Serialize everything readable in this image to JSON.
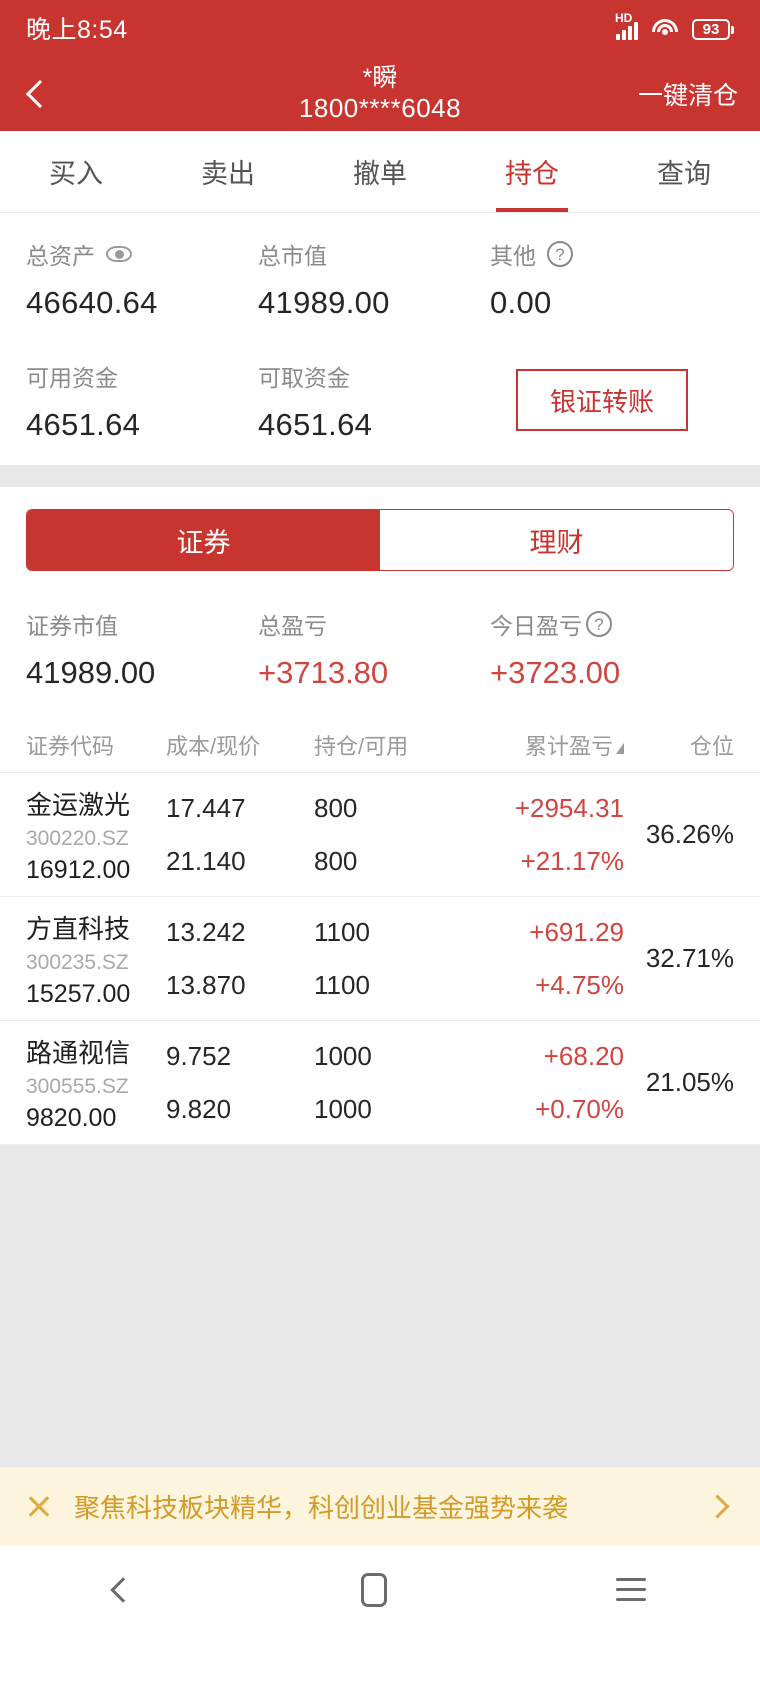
{
  "status_bar": {
    "time": "晚上8:54",
    "hd_label": "HD",
    "battery_level": "93",
    "icons": [
      "signal-icon",
      "wifi-icon",
      "battery-icon"
    ]
  },
  "header": {
    "back_icon": "chevron-left-icon",
    "title_line1": "*瞬",
    "title_line2": "1800****6048",
    "action_label": "一键清仓"
  },
  "tabs": [
    {
      "label": "买入",
      "active": false
    },
    {
      "label": "卖出",
      "active": false
    },
    {
      "label": "撤单",
      "active": false
    },
    {
      "label": "持仓",
      "active": true
    },
    {
      "label": "查询",
      "active": false
    }
  ],
  "assets": {
    "total_assets_label": "总资产",
    "total_assets_value": "46640.64",
    "total_market_value_label": "总市值",
    "total_market_value": "41989.00",
    "other_label": "其他",
    "other_value": "0.00",
    "available_cash_label": "可用资金",
    "available_cash_value": "4651.64",
    "withdrawable_cash_label": "可取资金",
    "withdrawable_cash_value": "4651.64",
    "transfer_button": "银证转账"
  },
  "segment": {
    "securities": "证券",
    "wealth": "理财",
    "active": "证券"
  },
  "pnl": {
    "market_value_label": "证券市值",
    "market_value": "41989.00",
    "total_pnl_label": "总盈亏",
    "total_pnl": "+3713.80",
    "today_pnl_label": "今日盈亏",
    "today_pnl": "+3723.00"
  },
  "table": {
    "headers": {
      "code": "证券代码",
      "cost_price": "成本/现价",
      "position_available": "持仓/可用",
      "cumulative_pnl": "累计盈亏",
      "weight": "仓位"
    },
    "rows": [
      {
        "name": "金运激光",
        "code": "300220.SZ",
        "market_value": "16912.00",
        "cost": "17.447",
        "price": "21.140",
        "position": "800",
        "available": "800",
        "pnl_amount": "+2954.31",
        "pnl_percent": "+21.17%",
        "weight": "36.26%"
      },
      {
        "name": "方直科技",
        "code": "300235.SZ",
        "market_value": "15257.00",
        "cost": "13.242",
        "price": "13.870",
        "position": "1100",
        "available": "1100",
        "pnl_amount": "+691.29",
        "pnl_percent": "+4.75%",
        "weight": "32.71%"
      },
      {
        "name": "路通视信",
        "code": "300555.SZ",
        "market_value": "9820.00",
        "cost": "9.752",
        "price": "9.820",
        "position": "1000",
        "available": "1000",
        "pnl_amount": "+68.20",
        "pnl_percent": "+0.70%",
        "weight": "21.05%"
      }
    ]
  },
  "promo": {
    "close_icon": "close-icon",
    "text": "聚焦科技板块精华，科创创业基金强势来袭",
    "arrow_icon": "chevron-right-icon"
  },
  "nav_bar": {
    "back": "back-icon",
    "home": "home-icon",
    "recents": "menu-icon"
  },
  "colors": {
    "brand_red": "#C83430",
    "accent_red": "#C8342F",
    "up_red": "#D0453F",
    "promo_bg": "#FCF4DC",
    "promo_text": "#D39A27",
    "divider": "#E9E9E9"
  }
}
